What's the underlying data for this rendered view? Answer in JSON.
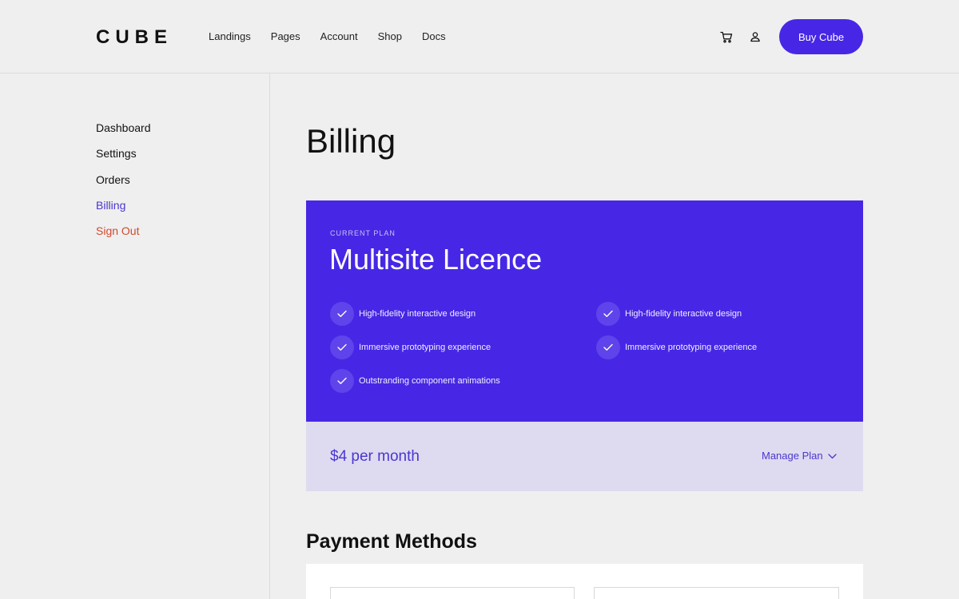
{
  "header": {
    "logo": "CUBE",
    "nav": [
      "Landings",
      "Pages",
      "Account",
      "Shop",
      "Docs"
    ],
    "icons": {
      "cart": "cart-icon",
      "user": "user-icon"
    },
    "cta_label": "Buy Cube"
  },
  "sidebar": {
    "items": [
      {
        "label": "Dashboard",
        "state": "normal"
      },
      {
        "label": "Settings",
        "state": "normal"
      },
      {
        "label": "Orders",
        "state": "normal"
      },
      {
        "label": "Billing",
        "state": "active"
      },
      {
        "label": "Sign Out",
        "state": "danger"
      }
    ]
  },
  "main": {
    "title": "Billing",
    "plan": {
      "label": "CURRENT PLAN",
      "name": "Multisite Licence",
      "features_left": [
        "High-fidelity interactive design",
        "Immersive prototyping experience",
        "Outstranding component animations"
      ],
      "features_right": [
        "High-fidelity interactive design",
        "Immersive prototyping experience"
      ],
      "price": "$4 per month",
      "manage_label": "Manage Plan"
    },
    "payment_title": "Payment Methods"
  },
  "colors": {
    "accent": "#4727e5",
    "active_link": "#4a36d0",
    "danger": "#cf4a2f",
    "price_bar": "#dedbf0",
    "background": "#efefef"
  }
}
